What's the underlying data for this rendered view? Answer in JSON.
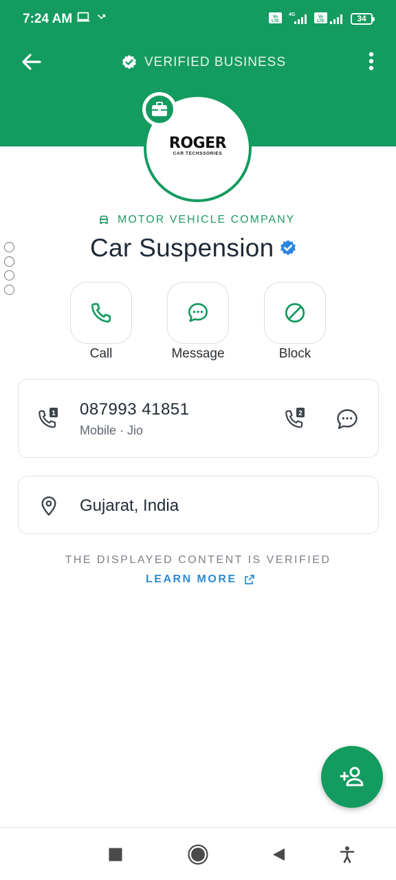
{
  "status_bar": {
    "time": "7:24 AM",
    "battery": "34",
    "icons": [
      "laptop-icon",
      "missed-call-icon",
      "volte-icon",
      "signal-4g-icon",
      "signal-icon",
      "battery-icon"
    ]
  },
  "header": {
    "title": "VERIFIED BUSINESS",
    "bg_color": "#149b5f",
    "back_icon": "arrow-left-icon",
    "menu_icon": "more-vertical-icon"
  },
  "profile": {
    "logo_text": "ROGER",
    "logo_subtext": "CAR TECHSSORIES",
    "category": "MOTOR VEHICLE COMPANY",
    "name": "Car Suspension"
  },
  "actions": [
    {
      "label": "Call",
      "icon": "phone-icon"
    },
    {
      "label": "Message",
      "icon": "chat-bubble-icon"
    },
    {
      "label": "Block",
      "icon": "block-icon"
    }
  ],
  "phone_card": {
    "number": "087993 41851",
    "subtitle": "Mobile · Jio"
  },
  "location_card": {
    "location": "Gujarat, India"
  },
  "footer": {
    "verified_note": "THE DISPLAYED CONTENT IS VERIFIED",
    "learn_more": "LEARN MORE"
  },
  "colors": {
    "accent": "#149b5f",
    "link": "#2a8bd2",
    "verified_badge": "#2a86e0"
  }
}
